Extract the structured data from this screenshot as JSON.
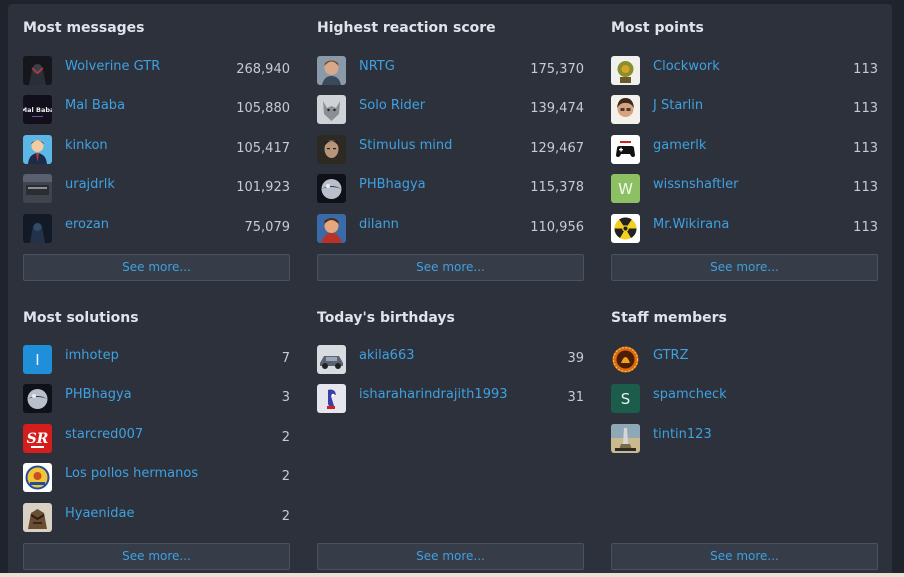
{
  "see_more": "See more...",
  "blocks": [
    {
      "title": "Most messages",
      "rows": [
        {
          "name": "Wolverine GTR",
          "value": "268,940"
        },
        {
          "name": "Mal Baba",
          "value": "105,880",
          "avatar_text": "Mal Baba"
        },
        {
          "name": "kinkon",
          "value": "105,417"
        },
        {
          "name": "urajdrlk",
          "value": "101,923"
        },
        {
          "name": "erozan",
          "value": "75,079"
        }
      ]
    },
    {
      "title": "Highest reaction score",
      "rows": [
        {
          "name": "NRTG",
          "value": "175,370"
        },
        {
          "name": "Solo Rider",
          "value": "139,474"
        },
        {
          "name": "Stimulus mind",
          "value": "129,467"
        },
        {
          "name": "PHBhagya",
          "value": "115,378"
        },
        {
          "name": "dilann",
          "value": "110,956"
        }
      ]
    },
    {
      "title": "Most points",
      "rows": [
        {
          "name": "Clockwork",
          "value": "113"
        },
        {
          "name": "J Starlin",
          "value": "113"
        },
        {
          "name": "gamerlk",
          "value": "113"
        },
        {
          "name": "wissnshaftler",
          "value": "113",
          "avatar_letter": "W"
        },
        {
          "name": "Mr.Wikirana",
          "value": "113"
        }
      ]
    },
    {
      "title": "Most solutions",
      "rows": [
        {
          "name": "imhotep",
          "value": "7",
          "avatar_letter": "I"
        },
        {
          "name": "PHBhagya",
          "value": "3"
        },
        {
          "name": "starcred007",
          "value": "2",
          "avatar_text": "SR"
        },
        {
          "name": "Los pollos hermanos",
          "value": "2"
        },
        {
          "name": "Hyaenidae",
          "value": "2"
        }
      ]
    },
    {
      "title": "Today's birthdays",
      "rows": [
        {
          "name": "akila663",
          "value": "39"
        },
        {
          "name": "isharaharindrajith1993",
          "value": "31"
        }
      ]
    },
    {
      "title": "Staff members",
      "rows": [
        {
          "name": "GTRZ"
        },
        {
          "name": "spamcheck",
          "avatar_letter": "S"
        },
        {
          "name": "tintin123"
        }
      ]
    }
  ]
}
